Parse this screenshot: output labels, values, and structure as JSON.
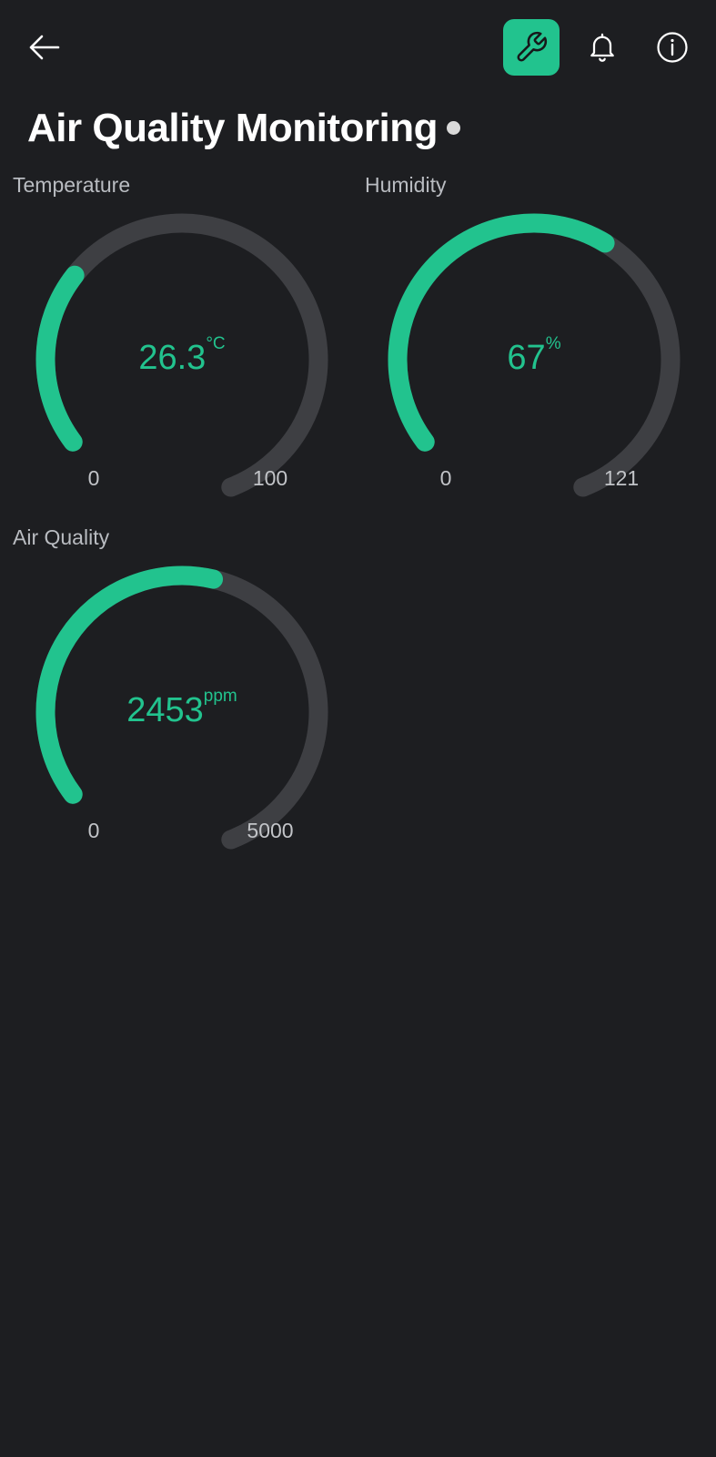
{
  "header": {
    "back_icon": "arrow-left-icon",
    "tool_icon": "wrench-icon",
    "bell_icon": "bell-icon",
    "info_icon": "info-icon"
  },
  "title": "Air Quality Monitoring",
  "colors": {
    "accent": "#22c38e",
    "track": "#3e3f43",
    "background": "#1d1e21",
    "status_dot": "#d9d9d9"
  },
  "gauges": [
    {
      "label": "Temperature",
      "value": 26.3,
      "value_text": "26.3",
      "unit": "°C",
      "min": 0,
      "max": 100,
      "min_text": "0",
      "max_text": "100"
    },
    {
      "label": "Humidity",
      "value": 67,
      "value_text": "67",
      "unit": "%",
      "min": 0,
      "max": 121,
      "min_text": "0",
      "max_text": "121"
    },
    {
      "label": "Air Quality",
      "value": 2453,
      "value_text": "2453",
      "unit": "ppm",
      "min": 0,
      "max": 5000,
      "min_text": "0",
      "max_text": "5000"
    }
  ]
}
